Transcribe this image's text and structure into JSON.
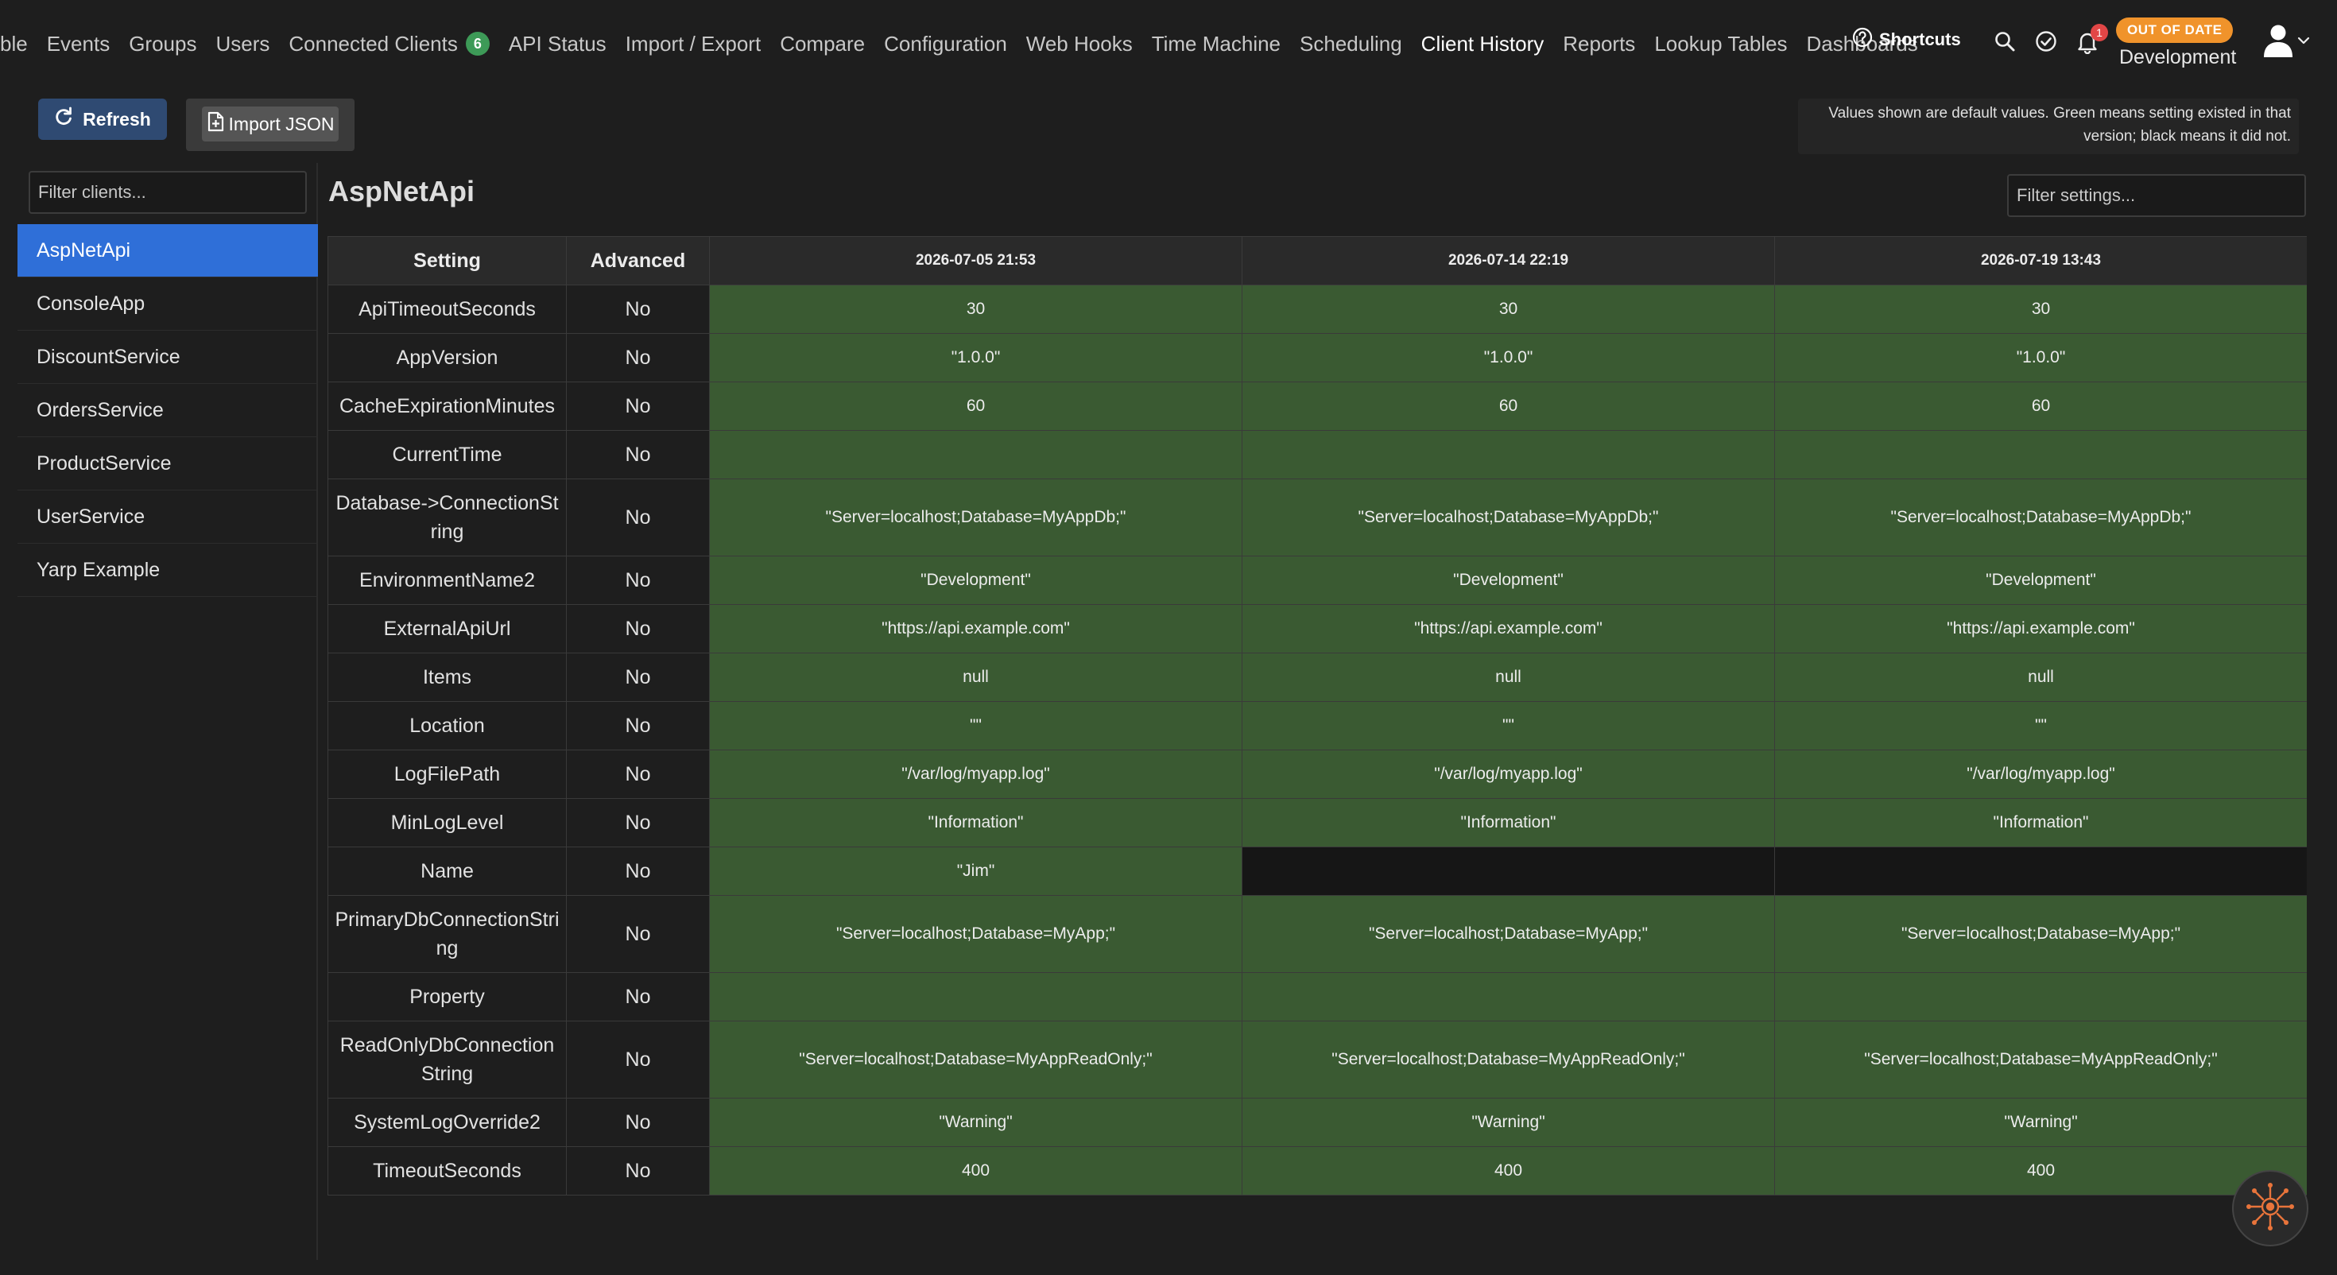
{
  "nav": {
    "items": [
      {
        "label": "ble"
      },
      {
        "label": "Events"
      },
      {
        "label": "Groups"
      },
      {
        "label": "Users"
      },
      {
        "label": "Connected Clients",
        "badge": "6"
      },
      {
        "label": "API Status"
      },
      {
        "label": "Import / Export"
      },
      {
        "label": "Compare"
      },
      {
        "label": "Configuration"
      },
      {
        "label": "Web Hooks"
      },
      {
        "label": "Time Machine"
      },
      {
        "label": "Scheduling"
      },
      {
        "label": "Client History",
        "active": true
      },
      {
        "label": "Reports"
      },
      {
        "label": "Lookup Tables"
      },
      {
        "label": "Dashboards"
      }
    ],
    "shortcuts_label": "Shortcuts",
    "notification_count": "1",
    "status_badge": "OUT OF DATE",
    "environment": "Development",
    "icons": [
      "question-circle-icon",
      "search-icon",
      "check-circle-icon",
      "bell-icon",
      "user-icon",
      "chevron-down-icon"
    ]
  },
  "toolbar": {
    "refresh_label": "Refresh",
    "import_label": "Import JSON",
    "info_note": "Values shown are default values. Green means setting existed in that version; black means it did not."
  },
  "sidebar": {
    "filter_placeholder": "Filter clients...",
    "clients": [
      "AspNetApi",
      "ConsoleApp",
      "DiscountService",
      "OrdersService",
      "ProductService",
      "UserService",
      "Yarp Example"
    ],
    "selected": "AspNetApi"
  },
  "main": {
    "title": "AspNetApi",
    "filter_placeholder": "Filter settings...",
    "columns": {
      "setting": "Setting",
      "advanced": "Advanced",
      "versions": [
        "2026-07-05 21:53",
        "2026-07-14 22:19",
        "2026-07-19 13:43"
      ]
    },
    "rows": [
      {
        "setting": "ApiTimeoutSeconds",
        "advanced": "No",
        "values": [
          "30",
          "30",
          "30"
        ]
      },
      {
        "setting": "AppVersion",
        "advanced": "No",
        "values": [
          "\"1.0.0\"",
          "\"1.0.0\"",
          "\"1.0.0\""
        ]
      },
      {
        "setting": "CacheExpirationMinutes",
        "advanced": "No",
        "values": [
          "60",
          "60",
          "60"
        ]
      },
      {
        "setting": "CurrentTime",
        "advanced": "No",
        "values": [
          "",
          "",
          ""
        ]
      },
      {
        "setting": "Database->ConnectionString",
        "advanced": "No",
        "values": [
          "\"Server=localhost;Database=MyAppDb;\"",
          "\"Server=localhost;Database=MyAppDb;\"",
          "\"Server=localhost;Database=MyAppDb;\""
        ]
      },
      {
        "setting": "EnvironmentName2",
        "advanced": "No",
        "values": [
          "\"Development\"",
          "\"Development\"",
          "\"Development\""
        ]
      },
      {
        "setting": "ExternalApiUrl",
        "advanced": "No",
        "values": [
          "\"https://api.example.com\"",
          "\"https://api.example.com\"",
          "\"https://api.example.com\""
        ]
      },
      {
        "setting": "Items",
        "advanced": "No",
        "values": [
          "null",
          "null",
          "null"
        ]
      },
      {
        "setting": "Location",
        "advanced": "No",
        "values": [
          "\"\"",
          "\"\"",
          "\"\""
        ]
      },
      {
        "setting": "LogFilePath",
        "advanced": "No",
        "values": [
          "\"/var/log/myapp.log\"",
          "\"/var/log/myapp.log\"",
          "\"/var/log/myapp.log\""
        ]
      },
      {
        "setting": "MinLogLevel",
        "advanced": "No",
        "values": [
          "\"Information\"",
          "\"Information\"",
          "\"Information\""
        ]
      },
      {
        "setting": "Name",
        "advanced": "No",
        "values": [
          "\"Jim\"",
          null,
          null
        ]
      },
      {
        "setting": "PrimaryDbConnectionString",
        "advanced": "No",
        "values": [
          "\"Server=localhost;Database=MyApp;\"",
          "\"Server=localhost;Database=MyApp;\"",
          "\"Server=localhost;Database=MyApp;\""
        ]
      },
      {
        "setting": "Property",
        "advanced": "No",
        "values": [
          "",
          "",
          ""
        ]
      },
      {
        "setting": "ReadOnlyDbConnectionString",
        "advanced": "No",
        "values": [
          "\"Server=localhost;Database=MyAppReadOnly;\"",
          "\"Server=localhost;Database=MyAppReadOnly;\"",
          "\"Server=localhost;Database=MyAppReadOnly;\""
        ]
      },
      {
        "setting": "SystemLogOverride2",
        "advanced": "No",
        "values": [
          "\"Warning\"",
          "\"Warning\"",
          "\"Warning\""
        ]
      },
      {
        "setting": "TimeoutSeconds",
        "advanced": "No",
        "values": [
          "400",
          "400",
          "400"
        ]
      }
    ]
  },
  "colors": {
    "present": "#3a5a32",
    "missing": "#161616",
    "accent": "#2f6fd8",
    "badge_green": "#3d9a57",
    "out_of_date": "#f0932b"
  }
}
